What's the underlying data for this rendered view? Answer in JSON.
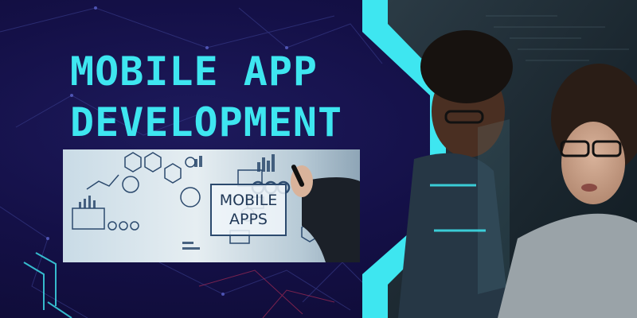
{
  "headline": {
    "line1": "MOBILE APP",
    "line2": "DEVELOPMENT"
  },
  "inset": {
    "line1": "MOBILE",
    "line2": "APPS"
  },
  "colors": {
    "accent": "#3ee6f0",
    "background": "#141047"
  }
}
